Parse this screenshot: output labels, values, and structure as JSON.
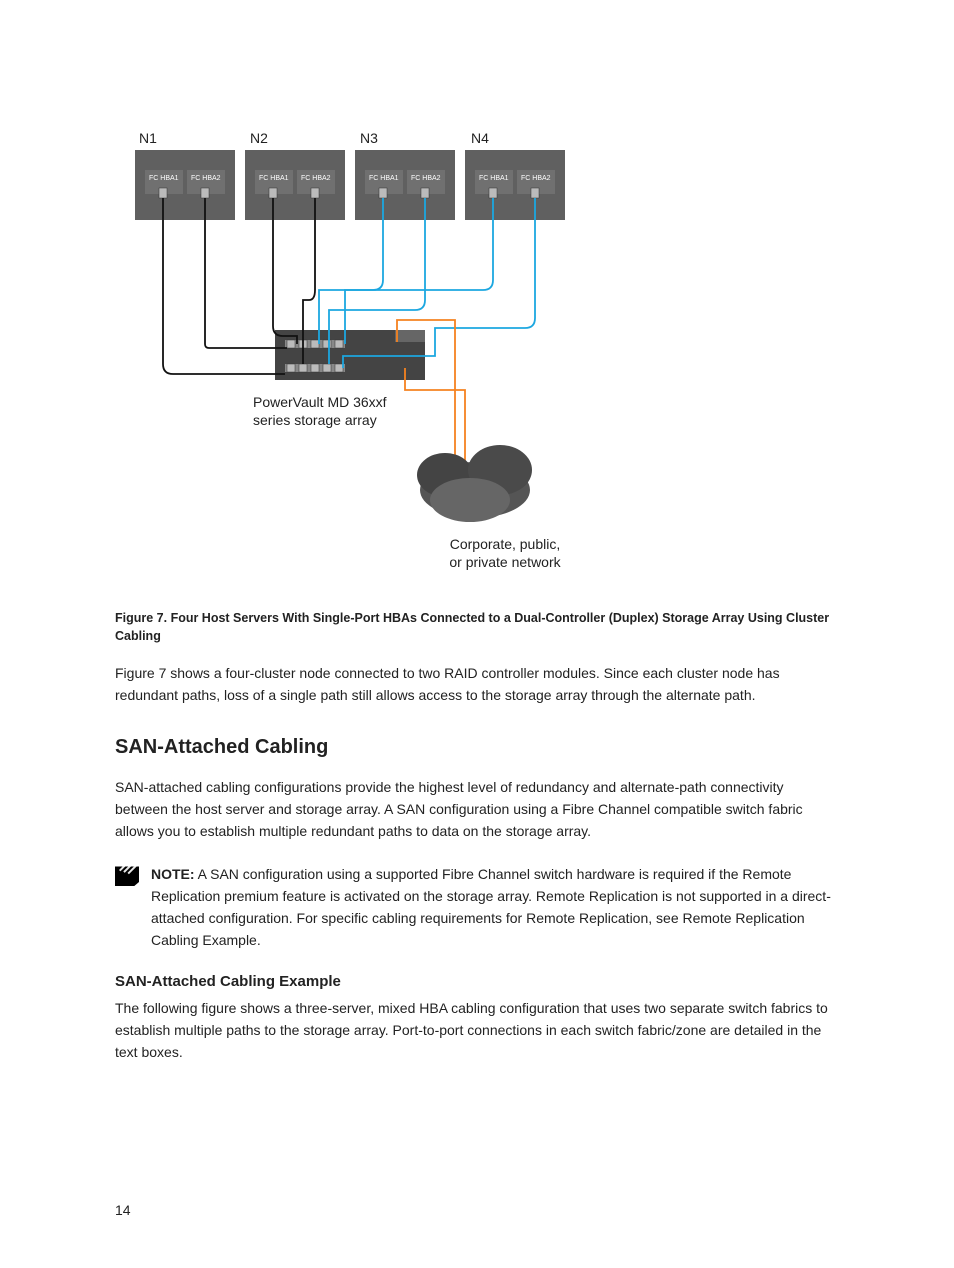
{
  "diagram": {
    "nodes": [
      "N1",
      "N2",
      "N3",
      "N4"
    ],
    "hba_labels": [
      "FC HBA1",
      "FC HBA2"
    ],
    "storage_label": "PowerVault MD 36xxf\nseries storage array",
    "network_label": "Corporate, public,\nor private network"
  },
  "figure_caption": "Figure 7. Four Host Servers With Single-Port HBAs Connected to a Dual-Controller (Duplex) Storage Array Using Cluster Cabling",
  "para1": "Figure 7 shows a four-cluster node connected to two RAID controller modules. Since each cluster node has redundant paths, loss of a single path still allows access to the storage array through the alternate path.",
  "section_heading": "SAN-Attached Cabling",
  "para2": "SAN-attached cabling configurations provide the highest level of redundancy and alternate-path connectivity between the host server and storage array. A SAN configuration using a Fibre Channel compatible switch fabric allows you to establish multiple redundant paths to data on the storage array.",
  "note": {
    "label": "NOTE:",
    "text": " A SAN configuration using a supported Fibre Channel switch hardware is required if the Remote Replication premium feature is activated on the storage array. Remote Replication is not supported in a direct-attached configuration. For specific cabling requirements for Remote Replication, see Remote Replication Cabling Example."
  },
  "subsection_heading": "SAN-Attached Cabling Example",
  "para3": "The following figure shows a three-server, mixed HBA cabling configuration that uses two separate switch fabrics to establish multiple paths to the storage array. Port-to-port connections in each switch fabric/zone are detailed in the text boxes.",
  "page_number": "14"
}
